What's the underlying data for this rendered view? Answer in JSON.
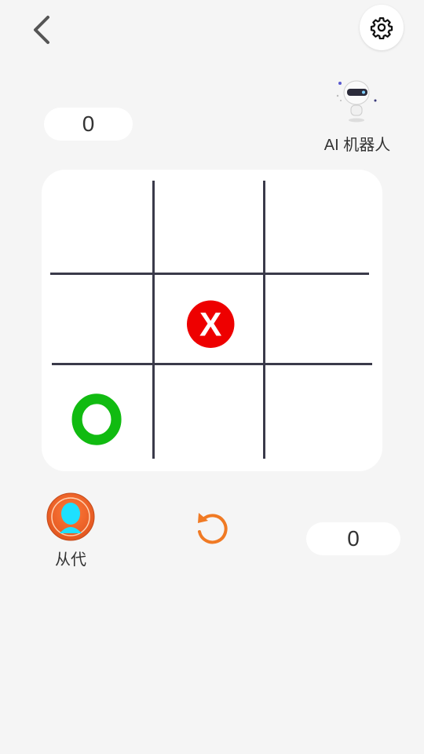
{
  "header": {
    "back_icon": "chevron-left-icon",
    "settings_icon": "gear-icon"
  },
  "opponent": {
    "name": "AI 机器人",
    "score": "0",
    "avatar_icon": "robot-avatar-icon"
  },
  "player": {
    "name": "从代",
    "score": "0",
    "avatar_icon": "user-avatar-icon"
  },
  "board": {
    "cells": [
      "",
      "",
      "",
      "",
      "X",
      "",
      "O",
      "",
      ""
    ],
    "colors": {
      "x": "#ee0000",
      "o": "#11bb11",
      "grid": "#3a3a4a"
    }
  },
  "controls": {
    "restart_icon": "restart-icon",
    "accent": "#f07a24"
  }
}
